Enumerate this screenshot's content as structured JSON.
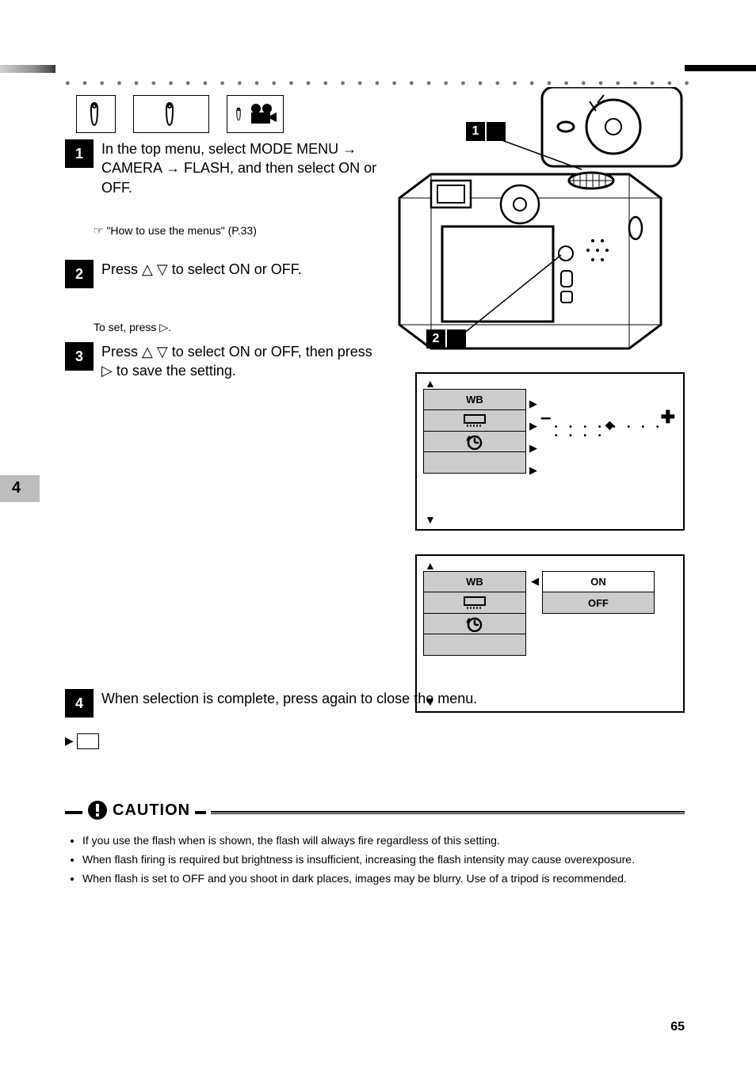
{
  "page": {
    "number": "65"
  },
  "side_num": "4",
  "steps": {
    "s1": {
      "num": "1",
      "text": "In the top menu, select MODE MENU → CAMERA → FLASH, and then select ON or OFF."
    },
    "s2": {
      "num": "2",
      "text": "Press △ ▽ to select ON or OFF."
    },
    "s2b": {
      "text": "To set, press ▷."
    },
    "s3": {
      "num": "3",
      "text": "Press △ ▽ to select ON or OFF, then press ▷ to save the setting."
    },
    "s4": {
      "num": "4",
      "text": "When selection is complete, press again to close the menu."
    }
  },
  "note1": "☞ \"How to use the menus\" (P.33)",
  "menu": {
    "items": [
      "WB",
      "",
      "",
      ""
    ],
    "wb": "WB"
  },
  "menu2": {
    "options": [
      "ON",
      "OFF"
    ],
    "selected": "OFF"
  },
  "slider_footer": "– – – – – –  ◆  – – – – – –",
  "caution": {
    "label": "CAUTION",
    "bullets": [
      "If you use the flash when     is shown, the flash will always fire regardless of this setting.",
      "When flash firing is required but brightness is insufficient, increasing the flash intensity may cause overexposure.",
      "When flash is set to OFF and you shoot in dark places, images may be blurry. Use of a tripod is recommended."
    ]
  },
  "callouts": {
    "a": "1",
    "b": "2"
  }
}
